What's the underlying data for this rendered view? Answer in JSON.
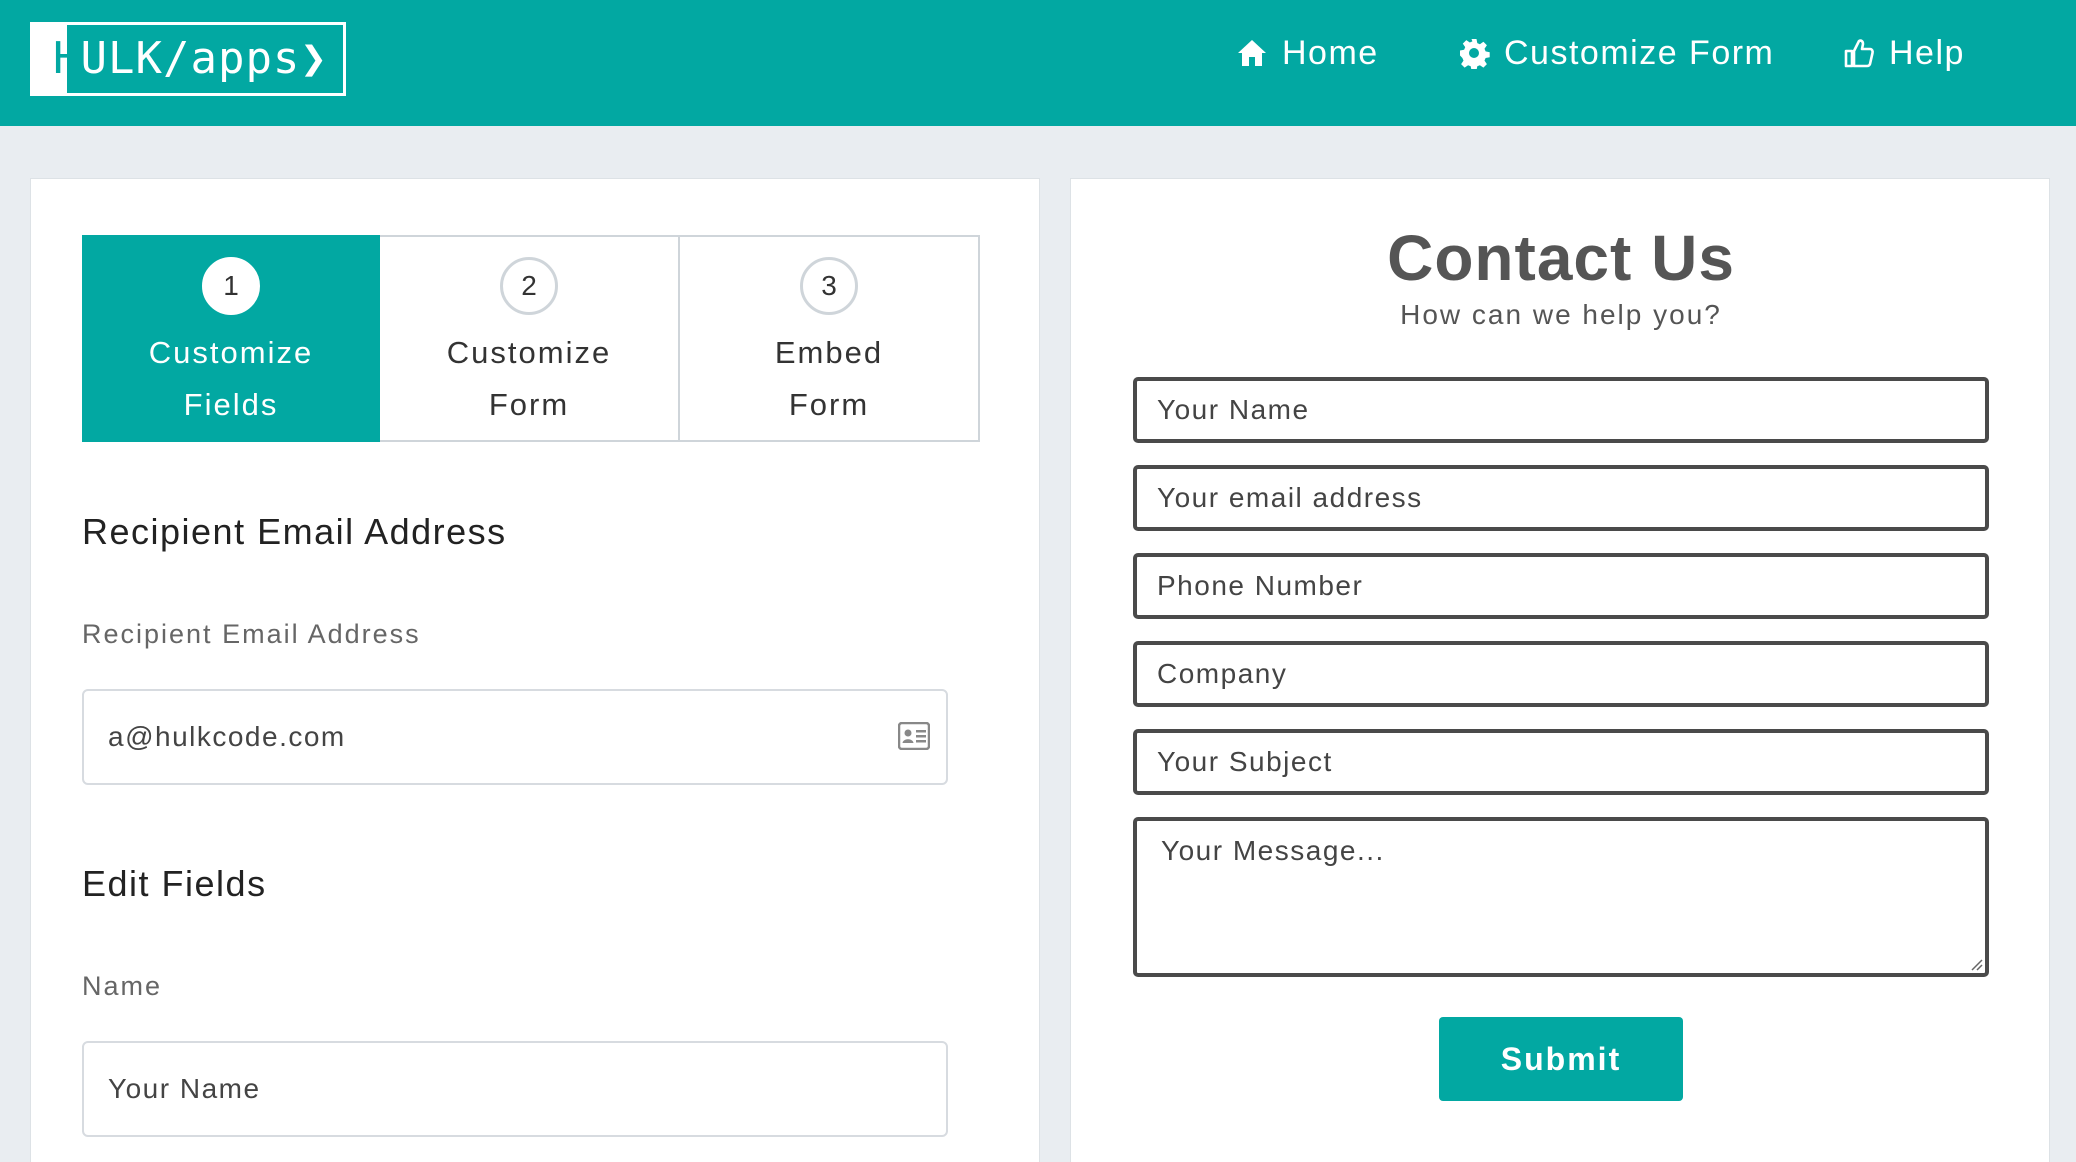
{
  "header": {
    "logo_first": "H",
    "logo_rest": "ULK/apps❯",
    "nav": [
      {
        "label": "Home",
        "icon": "home-icon"
      },
      {
        "label": "Customize Form",
        "icon": "gear-icon"
      },
      {
        "label": "Help",
        "icon": "thumbs-up-icon"
      }
    ]
  },
  "steps": [
    {
      "number": "1",
      "line1": "Customize",
      "line2": "Fields",
      "active": true
    },
    {
      "number": "2",
      "line1": "Customize",
      "line2": "Form",
      "active": false
    },
    {
      "number": "3",
      "line1": "Embed",
      "line2": "Form",
      "active": false
    }
  ],
  "recipient": {
    "section_title": "Recipient Email Address",
    "field_label": "Recipient Email Address",
    "value": "a@hulkcode.com",
    "icon": "address-card-icon"
  },
  "edit_fields": {
    "section_title": "Edit Fields",
    "name_label": "Name",
    "name_value": "Your Name"
  },
  "contact_form": {
    "title": "Contact Us",
    "subtitle": "How can we help you?",
    "fields": [
      "Your Name",
      "Your email address",
      "Phone Number",
      "Company",
      "Your Subject"
    ],
    "message_placeholder": "Your Message...",
    "submit_label": "Submit"
  },
  "colors": {
    "brand": "#02a8a2",
    "background": "#e9edf1",
    "border_dark": "#4a4a4a"
  }
}
